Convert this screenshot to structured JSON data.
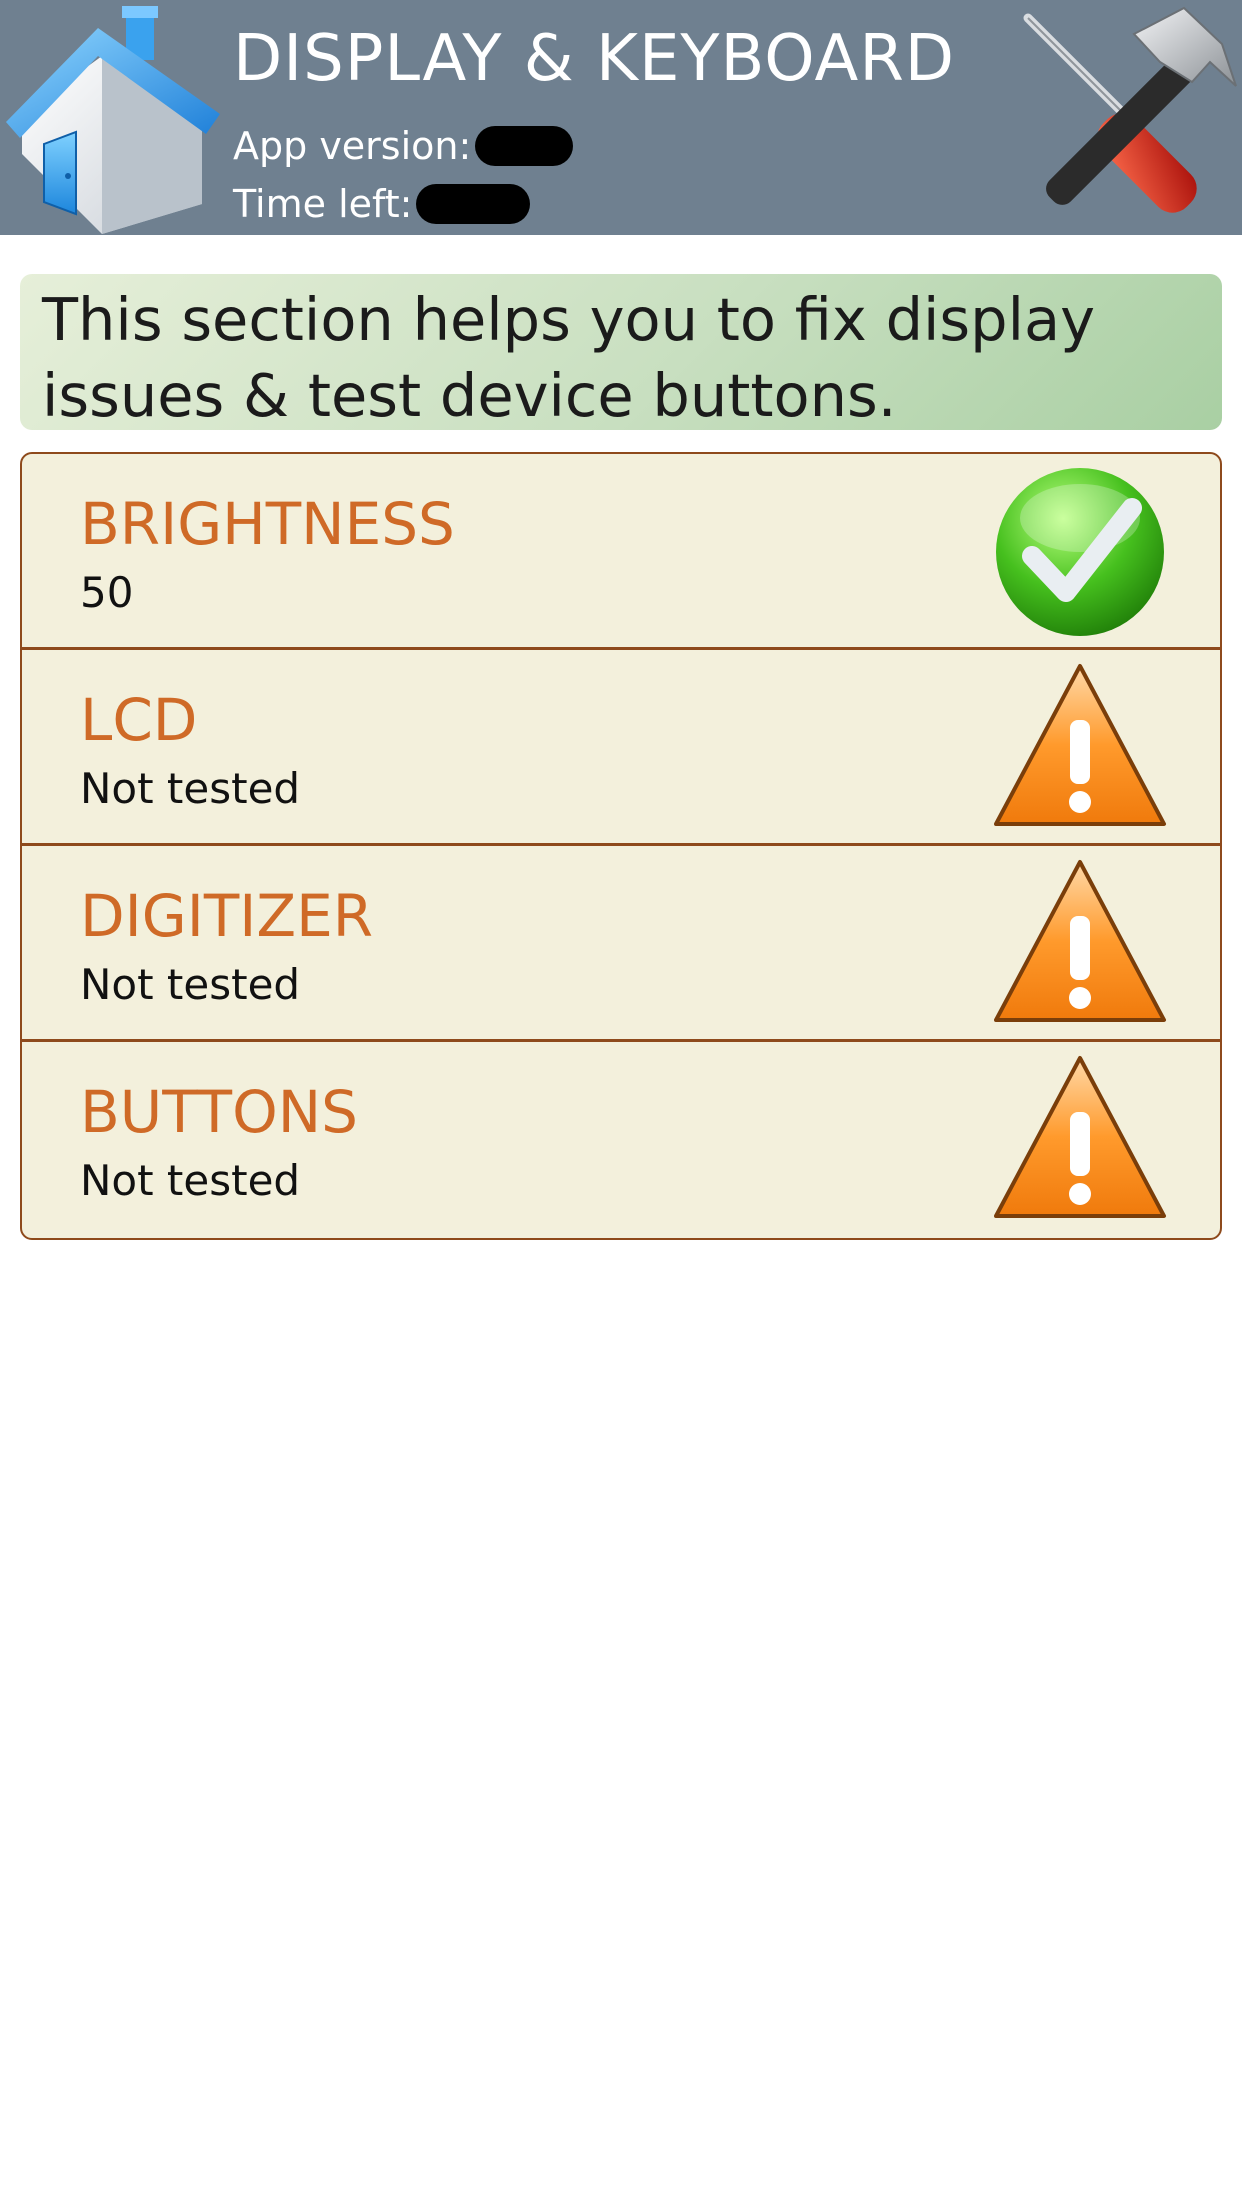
{
  "header": {
    "title": "DISPLAY & KEYBOARD",
    "app_version_label": "App version:",
    "time_left_label": "Time left:"
  },
  "banner": {
    "text": "This section helps you to fix display issues & test device buttons."
  },
  "tests": [
    {
      "name": "BRIGHTNESS",
      "status": "50",
      "icon": "check-icon"
    },
    {
      "name": "LCD",
      "status": "Not tested",
      "icon": "warning-icon"
    },
    {
      "name": "DIGITIZER",
      "status": "Not tested",
      "icon": "warning-icon"
    },
    {
      "name": "BUTTONS",
      "status": "Not tested",
      "icon": "warning-icon"
    }
  ],
  "colors": {
    "header_bg": "#6f8090",
    "item_title": "#cf6a27",
    "list_bg": "#f3f0dc",
    "list_border": "#8e4a1c",
    "banner_green": "#a9cfa3"
  }
}
